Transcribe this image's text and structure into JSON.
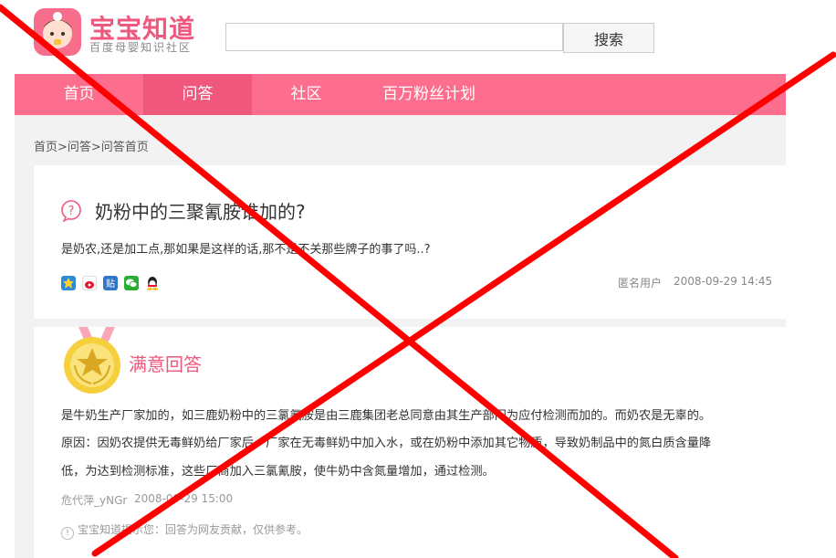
{
  "logo": {
    "name": "宝宝知道",
    "subtitle": "百度母婴知识社区"
  },
  "search": {
    "value": "",
    "button": "搜索"
  },
  "nav": [
    "首页",
    "问答",
    "社区",
    "百万粉丝计划"
  ],
  "breadcrumb": "首页>问答>问答首页",
  "question": {
    "title": "奶粉中的三聚氰胺谁加的?",
    "body": "是奶农,还是加工点,那如果是这样的话,那不是不关那些牌子的事了吗..?",
    "user": "匿名用户",
    "time": "2008-09-29 14:45",
    "share_icons": [
      "qzone-icon",
      "weibo-icon",
      "tieba-icon",
      "wechat-icon",
      "qq-icon"
    ]
  },
  "answer": {
    "label": "满意回答",
    "lines": [
      "是牛奶生产厂家加的，如三鹿奶粉中的三氯氰胺是由三鹿集团老总同意由其生产部门为应付检测而加的。而奶农是无辜的。",
      "原因：因奶农提供无毒鲜奶给厂家后，厂家在无毒鲜奶中加入水，或在奶粉中添加其它物质，导致奶制品中的氮白质含量降",
      "低，为达到检测标准，这些厂商加入三氯氰胺，使牛奶中含氮量增加，通过检测。"
    ],
    "user": "危代萍_yNGr",
    "time": "2008-09-29 15:00",
    "notice": "宝宝知道提示您：回答为网友贡献，仅供参考。"
  },
  "colors": {
    "brand": "#f0577d",
    "nav": "#fd6e8e",
    "nav_active": "#f0577d",
    "cross": "#ff0000"
  }
}
